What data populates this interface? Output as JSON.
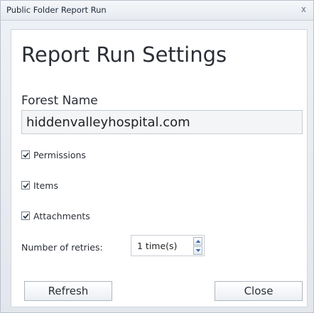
{
  "window": {
    "title": "Public Folder Report Run",
    "close_glyph": "x"
  },
  "main": {
    "heading": "Report Run Settings",
    "forest_label": "Forest Name",
    "forest_value": "hiddenvalleyhospital.com"
  },
  "options": [
    {
      "label": "Permissions",
      "checked": true
    },
    {
      "label": "Items",
      "checked": true
    },
    {
      "label": "Attachments",
      "checked": true
    }
  ],
  "retries": {
    "label": "Number of retries:",
    "value": "1 time(s)"
  },
  "buttons": {
    "refresh": "Refresh",
    "close": "Close"
  },
  "icons": {
    "checkbox": "checkmark-icon",
    "spin_up": "triangle-up-icon",
    "spin_down": "triangle-down-icon"
  },
  "colors": {
    "window_bg": "#e3e7ed",
    "panel_bg": "#ffffff",
    "border": "#cfd6de",
    "text": "#2a2f36"
  }
}
